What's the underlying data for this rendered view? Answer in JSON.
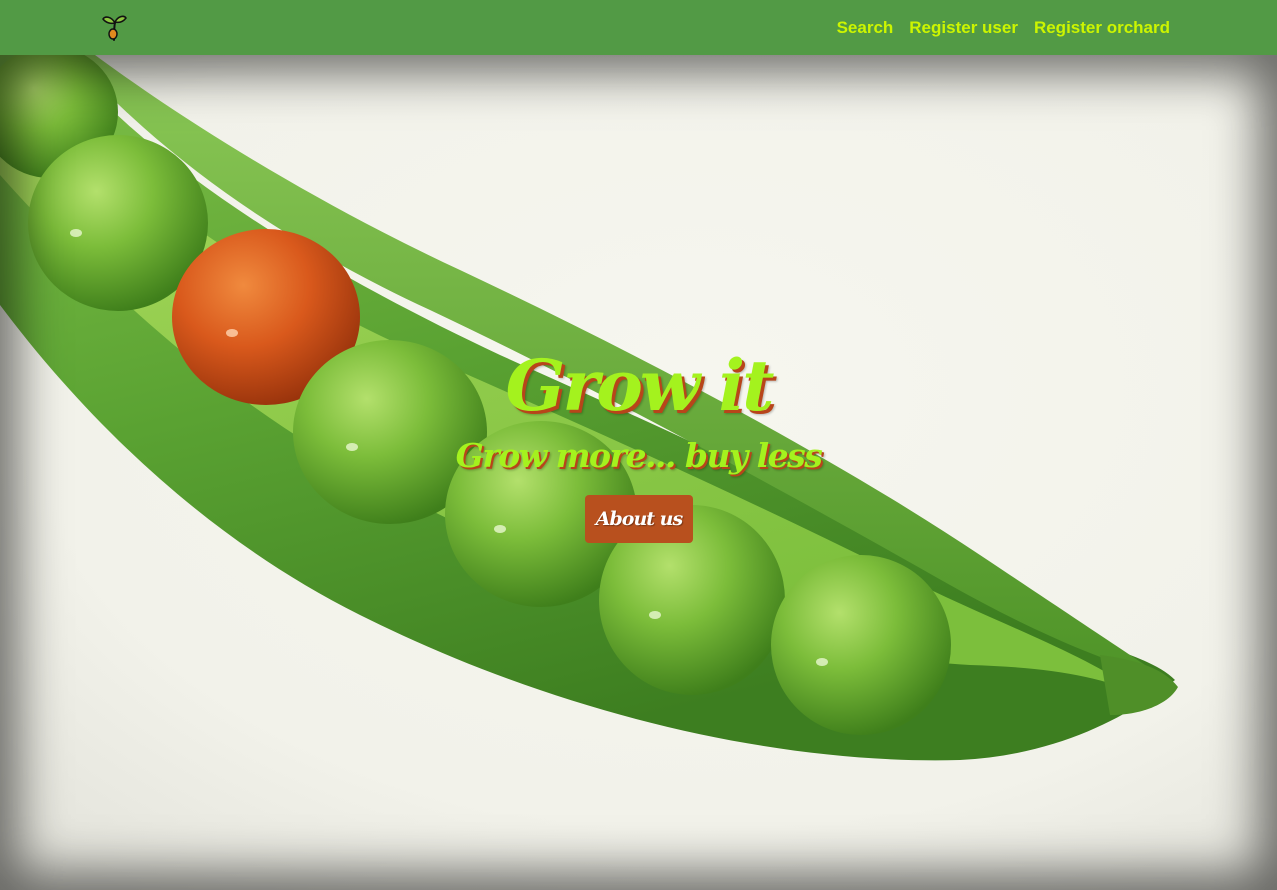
{
  "navbar": {
    "logo_icon": "sprout-icon",
    "background_color": "#529a45",
    "link_color": "#ccf500",
    "links": [
      {
        "label": "Search"
      },
      {
        "label": "Register user"
      },
      {
        "label": "Register orchard"
      }
    ]
  },
  "hero": {
    "background_image": "pea-pod-with-one-orange-pea",
    "title": "Grow it",
    "subtitle": "Grow more... buy less",
    "cta_label": "About us",
    "title_color": "#a4f21e",
    "cta_color": "#b8501e"
  }
}
